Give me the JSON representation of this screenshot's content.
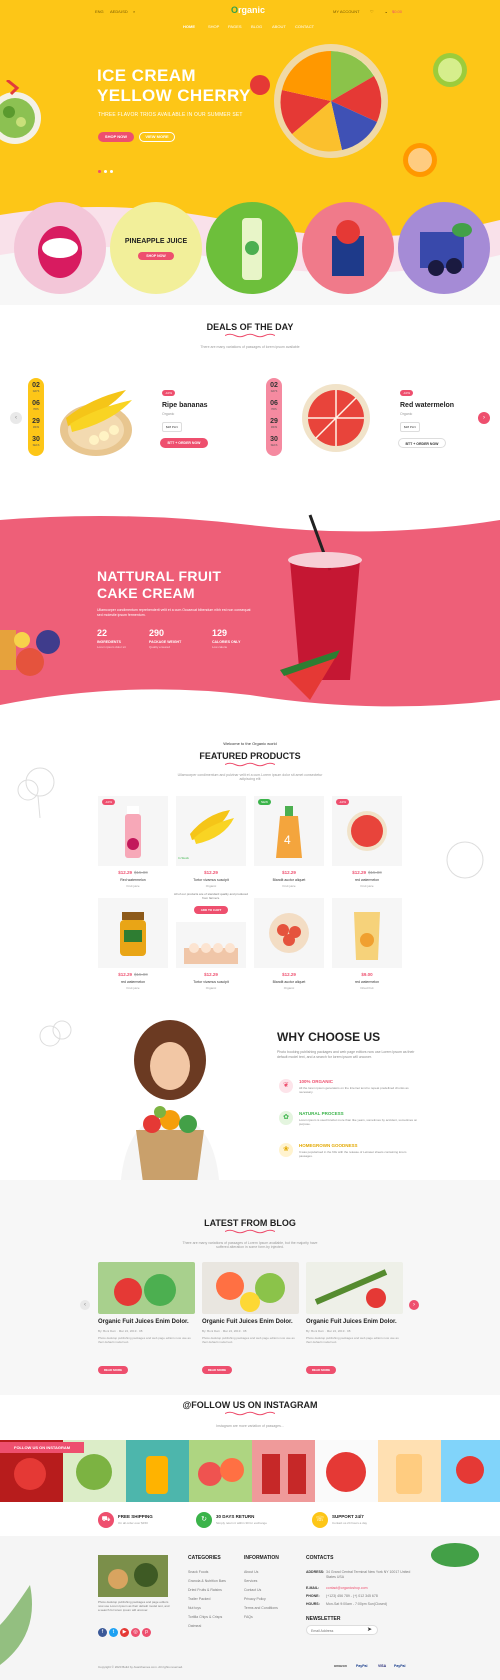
{
  "topbar": {
    "lang": "ENG",
    "currency": "AED/USD",
    "account": "MY ACCOUNT",
    "cart_total": "$0.00"
  },
  "logo": {
    "text": "rganic",
    "letter": "O"
  },
  "nav": [
    "HOME",
    "SHOP",
    "PAGES",
    "BLOG",
    "ABOUT",
    "CONTACT"
  ],
  "hero": {
    "title_line1": "ICE CREAM",
    "title_line2": "YELLOW CHERRY",
    "subtitle": "THREE FLAVOR TRIOS AVAILABLE IN OUR SUMMER SET",
    "btn_shop": "SHOP NOW",
    "btn_view": "VIEW MORE"
  },
  "category_feature": {
    "label": "PINEAPPLE JUICE",
    "button": "SHOP NOW"
  },
  "deals": {
    "title": "DEALS OF THE DAY",
    "subtitle": "There are many variations of passages of lorem ipsum available",
    "items": [
      {
        "name": "Ripe bananas",
        "cat": "Organic",
        "tag": "-10%",
        "price": "$28 PLN",
        "btn": "BTT + ORDER NOW",
        "dates": [
          {
            "n": "02",
            "l": "DAYS"
          },
          {
            "n": "06",
            "l": "HRS"
          },
          {
            "n": "29",
            "l": "MINS"
          },
          {
            "n": "30",
            "l": "SECS"
          }
        ]
      },
      {
        "name": "Red watermelon",
        "cat": "Organic",
        "tag": "-10%",
        "price": "$28 PLN",
        "btn": "BTT + ORDER NOW",
        "dates": [
          {
            "n": "02",
            "l": "DAYS"
          },
          {
            "n": "06",
            "l": "HRS"
          },
          {
            "n": "29",
            "l": "MINS"
          },
          {
            "n": "30",
            "l": "SECS"
          }
        ]
      }
    ]
  },
  "feature": {
    "title_line1": "NATTURAL FRUIT",
    "title_line2": "CAKE CREAM",
    "text": "Ullamcorper condimentum reprehenderit velit et a cum.Occaecat bibendum nibh est non consequat sed molestie ipsum fermentum.",
    "stats": [
      {
        "num": "22",
        "lbl": "INGREDIENTS",
        "sub": "Lorem ipsum dolor sit"
      },
      {
        "num": "290",
        "lbl": "PACKAGE WEIGHT",
        "sub": "Quality ensured"
      },
      {
        "num": "129",
        "lbl": "CALORIES ONLY",
        "sub": "Low calorie"
      }
    ]
  },
  "products": {
    "welcome": "Welcome to the Organic world",
    "title": "FEATURED PRODUCTS",
    "subtitle": "Ullamcorper condimentum and pulvinar velit et a cum.Lorem ipsum dolor sit amet consectetur adipiscing elit",
    "items": [
      {
        "tag": "-10%",
        "price": "$12.29",
        "old": "$15.00",
        "name": "Red watermelon",
        "cat": "Fruit juice"
      },
      {
        "tag": "",
        "price": "$12.29",
        "old": "",
        "name": "Tortor vivamus suscipit",
        "cat": "Organic"
      },
      {
        "tag": "NEW",
        "price": "$12.29",
        "old": "",
        "name": "Blandit auctor aliquet",
        "cat": "Fruit juice"
      },
      {
        "tag": "-10%",
        "price": "$12.29",
        "old": "$15.00",
        "name": "red watermelon",
        "cat": "Fruit juice"
      },
      {
        "tag": "",
        "price": "$12.29",
        "old": "$15.00",
        "name": "red watermelon",
        "cat": "Fruit juice"
      },
      {
        "tag": "",
        "price": "$12.29",
        "old": "",
        "name": "Tortor vivamus suscipit",
        "cat": "Organic"
      },
      {
        "tag": "",
        "price": "$12.29",
        "old": "",
        "name": "Blandit auctor aliquet",
        "cat": "Organic"
      },
      {
        "tag": "",
        "price": "$9.00",
        "old": "",
        "name": "red watermelon",
        "cat": "Dried fruit"
      }
    ],
    "hover_stock": "In Stock",
    "hover_text": "All of our products are of standard quality and produced from farmers.",
    "add_to_cart": "ADD TO CART"
  },
  "why": {
    "title": "WHY CHOOSE US",
    "text": "Photo booking publishing packages and web page editors now use Lorem Ipsum as their default model text, and a search for lorem ipsum will uncover.",
    "points": [
      {
        "title": "100% ORGANIC",
        "text": "All the lorem ipsum generators on the Internet tend to repeat predefined chunks as necessary."
      },
      {
        "title": "NATURAL PROCESS",
        "text": "Lorem ipsum is used forebut more than like years, sometimes by accident, sometimes on purpose."
      },
      {
        "title": "HOMEGROWN GOODNESS",
        "text": "It was popularised in the 60s with the release of Letraset sheets containing lorem passages."
      }
    ]
  },
  "blog": {
    "title": "LATEST FROM BLOG",
    "subtitle": "There are many variations of passages of Lorem Ipsum available, but the majority have suffered alteration in some form.by injected.",
    "posts": [
      {
        "title": "Organic Fuit Juices Enim Dolor.",
        "author": "By: Boni Dwn",
        "date": "Mar 24, 2019",
        "comments": "08",
        "text": "Photo desktop publishing packages and web page editors now use as their default model text.",
        "btn": "READ MORE"
      },
      {
        "title": "Organic Fuit Juices Enim Dolor.",
        "author": "By: Boni Dwn",
        "date": "Mar 24, 2019",
        "comments": "08",
        "text": "Photo desktop publishing packages and web page editors now use as their default model text.",
        "btn": "READ MORE"
      },
      {
        "title": "Organic Fuit Juices Enim Dolor.",
        "author": "By: Boni Dwn",
        "date": "Mar 24, 2019",
        "comments": "08",
        "text": "Photo desktop publishing packages and web page editors now use as their default model text.",
        "btn": "READ MORE"
      }
    ]
  },
  "instagram": {
    "title": "@FOLLOW US ON INSTAGRAM",
    "subtitle": "Instagram are more variation of passages...",
    "label": "FOLLOW US ON INSTAGRAM"
  },
  "features": [
    {
      "title": "FREE SHIPPING",
      "sub": "On all order over $150"
    },
    {
      "title": "30 DAYS RETURN",
      "sub": "Simply return it within 30 for exchange"
    },
    {
      "title": "SUPPORT 24/7",
      "sub": "Contact us 24 hours a day"
    }
  ],
  "footer": {
    "about": "Photo desktop publishing packages and page editors now use Lorem Ipsum as their default model text, and a search for lorem ipsum will uncover.",
    "categories_title": "CATEGORIES",
    "categories": [
      "Snack Foods",
      "Granola & Nutrition Bars",
      "Dried Fruits & Raisins",
      "Trailer Packed",
      "Nut toys",
      "Tortilla Chips & Crisps",
      "Oatmeal"
    ],
    "info_title": "INFORMATION",
    "info": [
      "About Us",
      "Services",
      "Contact Us",
      "Privacy Policy",
      "Terms and Conditions",
      "FAQs"
    ],
    "contact_title": "CONTACTS",
    "contact": [
      {
        "k": "ADDRESS:",
        "v": "34 Grand Central Terminal New York NY 10017 United States USA"
      },
      {
        "k": "E-MAIL:",
        "v": "contact@organicshop.com"
      },
      {
        "k": "PHONE:",
        "v": "(+123) 456 789 - (+) 012 345 678"
      },
      {
        "k": "HOURS:",
        "v": "Mon-Sat 9:00am - 7:00pm Sun(Closed)"
      }
    ],
    "newsletter_title": "NEWSLETTER",
    "newsletter_placeholder": "Email Address",
    "copyright": "Copyright © 2020 Build by Avanthemes.com. All rights reserved.",
    "payments": [
      "amazon",
      "PayPal",
      "VISA",
      "PayPal"
    ]
  },
  "colors": {
    "yellow": "#fdc617",
    "pink": "#ee4f6e",
    "green": "#3bb34a"
  }
}
